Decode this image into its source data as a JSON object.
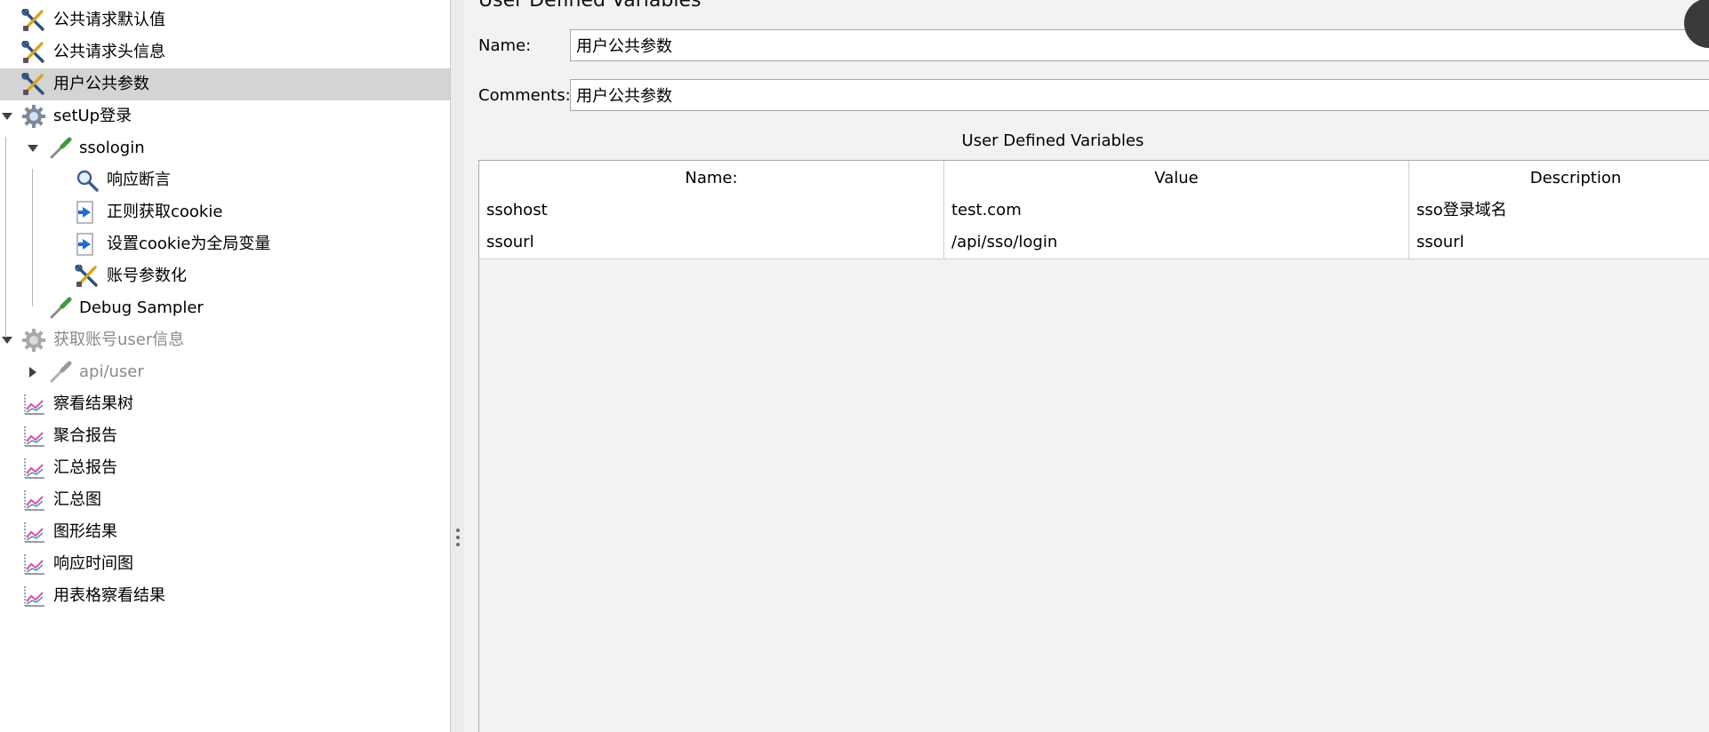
{
  "tree": {
    "items": [
      {
        "label": "公共请求默认值",
        "icon": "config-tools-icon",
        "depth": 1,
        "selected": false,
        "disabled": false,
        "toggle": "none"
      },
      {
        "label": "公共请求头信息",
        "icon": "config-tools-icon",
        "depth": 1,
        "selected": false,
        "disabled": false,
        "toggle": "none"
      },
      {
        "label": "用户公共参数",
        "icon": "config-tools-icon",
        "depth": 1,
        "selected": true,
        "disabled": false,
        "toggle": "none"
      },
      {
        "label": "setUp登录",
        "icon": "thread-group-gear-icon",
        "depth": 1,
        "selected": false,
        "disabled": false,
        "toggle": "expanded"
      },
      {
        "label": "ssologin",
        "icon": "sampler-pipette-icon",
        "depth": 2,
        "selected": false,
        "disabled": false,
        "toggle": "expanded"
      },
      {
        "label": "响应断言",
        "icon": "assertion-magnifier-icon",
        "depth": 3,
        "selected": false,
        "disabled": false,
        "toggle": "none"
      },
      {
        "label": "正则获取cookie",
        "icon": "post-processor-arrow-icon",
        "depth": 3,
        "selected": false,
        "disabled": false,
        "toggle": "none"
      },
      {
        "label": "设置cookie为全局变量",
        "icon": "post-processor-arrow-icon",
        "depth": 3,
        "selected": false,
        "disabled": false,
        "toggle": "none"
      },
      {
        "label": "账号参数化",
        "icon": "config-tools-icon",
        "depth": 3,
        "selected": false,
        "disabled": false,
        "toggle": "none"
      },
      {
        "label": "Debug Sampler",
        "icon": "sampler-pipette-icon",
        "depth": 2,
        "selected": false,
        "disabled": false,
        "toggle": "none"
      },
      {
        "label": "获取账号user信息",
        "icon": "thread-group-gear-icon",
        "depth": 1,
        "selected": false,
        "disabled": true,
        "toggle": "expanded"
      },
      {
        "label": "api/user",
        "icon": "sampler-pipette-icon",
        "depth": 2,
        "selected": false,
        "disabled": true,
        "toggle": "collapsed"
      },
      {
        "label": "察看结果树",
        "icon": "listener-graph-icon",
        "depth": 1,
        "selected": false,
        "disabled": false,
        "toggle": "none"
      },
      {
        "label": "聚合报告",
        "icon": "listener-graph-icon",
        "depth": 1,
        "selected": false,
        "disabled": false,
        "toggle": "none"
      },
      {
        "label": "汇总报告",
        "icon": "listener-graph-icon",
        "depth": 1,
        "selected": false,
        "disabled": false,
        "toggle": "none"
      },
      {
        "label": "汇总图",
        "icon": "listener-graph-icon",
        "depth": 1,
        "selected": false,
        "disabled": false,
        "toggle": "none"
      },
      {
        "label": "图形结果",
        "icon": "listener-graph-icon",
        "depth": 1,
        "selected": false,
        "disabled": false,
        "toggle": "none"
      },
      {
        "label": "响应时间图",
        "icon": "listener-graph-icon",
        "depth": 1,
        "selected": false,
        "disabled": false,
        "toggle": "none"
      },
      {
        "label": "用表格察看结果",
        "icon": "listener-graph-icon",
        "depth": 1,
        "selected": false,
        "disabled": false,
        "toggle": "none"
      }
    ]
  },
  "panel": {
    "title": "User Defined Variables",
    "name_label": "Name:",
    "name_value": "用户公共参数",
    "comments_label": "Comments:",
    "comments_value": "用户公共参数",
    "table_caption": "User Defined Variables",
    "table": {
      "headers": [
        "Name:",
        "Value",
        "Description"
      ],
      "rows": [
        [
          "ssohost",
          "test.com",
          "sso登录域名"
        ],
        [
          "ssourl",
          "/api/sso/login",
          "ssourl"
        ]
      ]
    }
  },
  "colors": {
    "selected_row": "#d4d4d4",
    "panel_background": "#f2f2f2",
    "disabled_text": "#8a8a8a",
    "tools_blue": "#2f4f7f",
    "tools_gold": "#d9a21b",
    "gear_gray": "#7d8a99",
    "pipette_green": "#3d9a3d",
    "arrow_blue": "#1e6fd0",
    "graph_pink": "#e05aa0"
  }
}
